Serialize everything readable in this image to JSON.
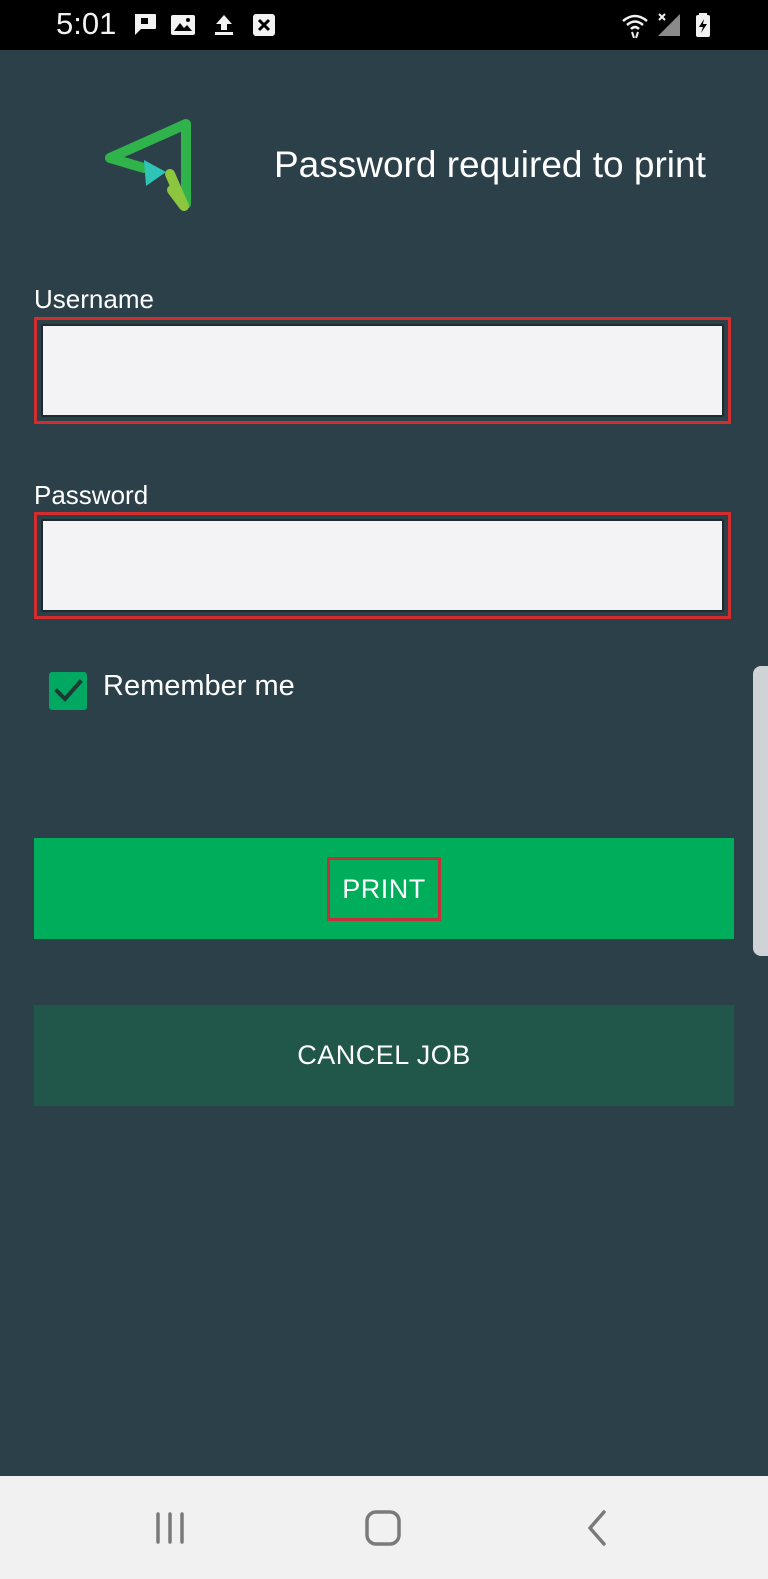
{
  "status_bar": {
    "time": "5:01",
    "left_icons": [
      "message-icon",
      "image-icon",
      "upload-icon",
      "close-box-icon"
    ],
    "right_icons": [
      "wifi-icon",
      "no-signal-icon",
      "battery-charging-icon"
    ]
  },
  "header": {
    "title": "Password required to print",
    "logo": "app-logo"
  },
  "form": {
    "username_label": "Username",
    "username_value": "",
    "password_label": "Password",
    "password_value": "",
    "remember_label": "Remember me",
    "remember_checked": true
  },
  "buttons": {
    "print_label": "PRINT",
    "cancel_label": "CANCEL JOB"
  },
  "colors": {
    "background": "#2b4048",
    "accent_green": "#00ad5b",
    "cancel_green": "#20574a",
    "highlight_red": "#d42d2d"
  },
  "nav_bar": {
    "icons": [
      "recent-apps-icon",
      "home-icon",
      "back-icon"
    ]
  }
}
